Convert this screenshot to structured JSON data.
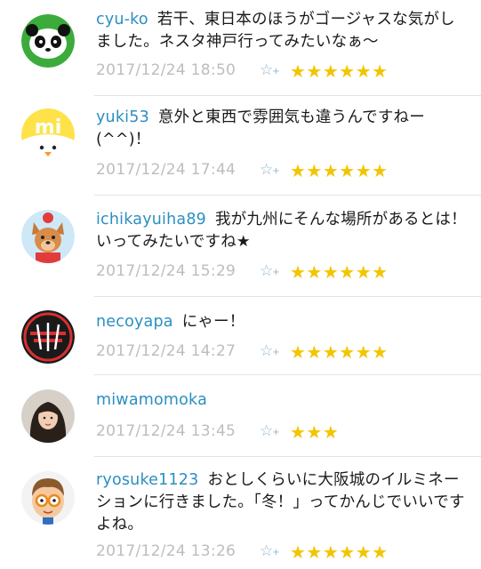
{
  "colors": {
    "username": "#2b8fc1",
    "star": "#f2c500",
    "date": "#bdbdbd",
    "add_star": "#8fb3ce"
  },
  "icons": {
    "add_star": "add-star-icon",
    "rated_star": "star-icon"
  },
  "comments": [
    {
      "user": "cyu-ko",
      "text": "若干、東日本のほうがゴージャスな気がしました。ネスタ神戸行ってみたいなぁ～",
      "date": "2017/12/24 18:50",
      "stars": "★★★★★★",
      "star_count": 6,
      "avatar": "panda-avatar"
    },
    {
      "user": "yuki53",
      "text": "意外と東西で雰囲気も違うんですねー(^^)！",
      "date": "2017/12/24 17:44",
      "stars": "★★★★★★",
      "star_count": 6,
      "avatar": "yellow-chick-avatar"
    },
    {
      "user": "ichikayuiha89",
      "text": "我が九州にそんな場所があるとは！いってみたいですね★",
      "date": "2017/12/24 15:29",
      "stars": "★★★★★★",
      "star_count": 6,
      "avatar": "dog-character-avatar"
    },
    {
      "user": "necoyapa",
      "text": "にゃー！",
      "date": "2017/12/24 14:27",
      "stars": "★★★★★★",
      "star_count": 6,
      "avatar": "red-stamp-avatar"
    },
    {
      "user": "miwamomoka",
      "text": "",
      "date": "2017/12/24 13:45",
      "stars": "★★★",
      "star_count": 3,
      "avatar": "woman-photo-avatar"
    },
    {
      "user": "ryosuke1123",
      "text": "おとしくらいに大阪城のイルミネーションに行きました。「冬！」ってかんじでいいですよね。",
      "date": "2017/12/24 13:26",
      "stars": "★★★★★★",
      "star_count": 6,
      "avatar": "boy-glasses-avatar"
    }
  ]
}
